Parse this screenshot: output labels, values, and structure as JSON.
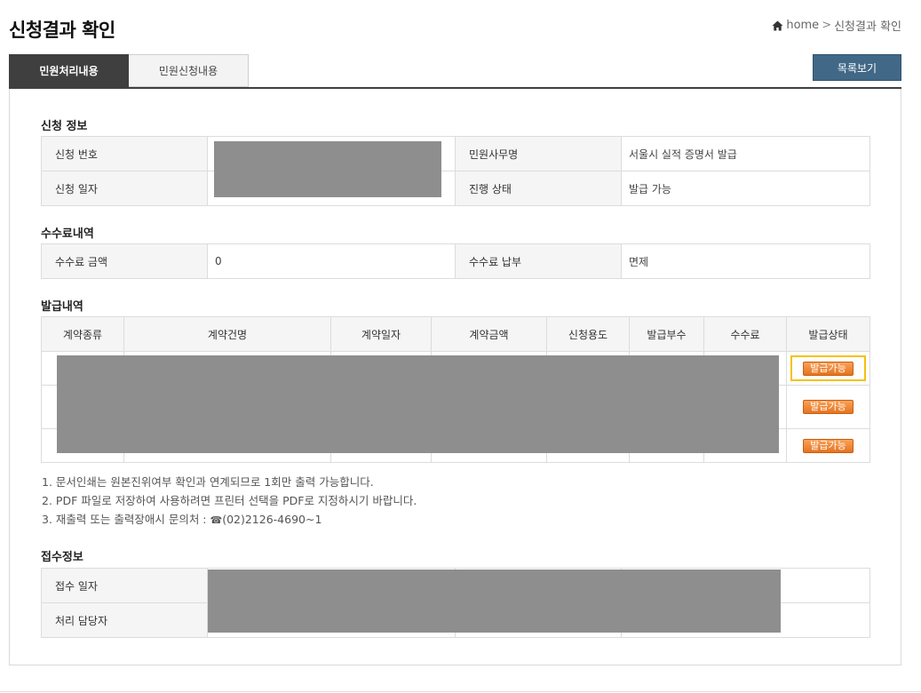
{
  "page": {
    "title": "신청결과 확인"
  },
  "breadcrumb": {
    "home_icon": "home-icon",
    "home": "home",
    "separator": ">",
    "current": "신청결과 확인"
  },
  "tabs": [
    {
      "label": "민원처리내용",
      "active": true
    },
    {
      "label": "민원신청내용",
      "active": false
    }
  ],
  "list_button": {
    "label": "목록보기",
    "color": "#416886"
  },
  "application_info": {
    "title": "신청 정보",
    "number_label": "신청 번호",
    "date_label": "신청 일자",
    "office_label": "민원사무명",
    "office_value": "서울시 실적 증명서 발급",
    "status_label": "진행 상태",
    "status_value": "발급 가능"
  },
  "fee_info": {
    "title": "수수료내역",
    "amount_label": "수수료 금액",
    "amount_value": "0",
    "payment_label": "수수료 납부",
    "payment_value": "면제"
  },
  "issue_info": {
    "title": "발급내역",
    "columns": [
      "계약종류",
      "계약건명",
      "계약일자",
      "계약금액",
      "신청용도",
      "발급부수",
      "수수료",
      "발급상태"
    ],
    "rows": [
      {
        "status": "발급가능"
      },
      {
        "status": "발급가능"
      },
      {
        "status": "발급가능"
      }
    ],
    "badge_color": "#ec7f2c",
    "focus_color": "#f4c20d"
  },
  "notes": {
    "line1": "1. 문서인쇄는 원본진위여부 확인과 연계되므로 1회만 출력 가능합니다.",
    "line2": "2. PDF 파일로 저장하여 사용하려면 프린터 선택을 PDF로 지정하시기 바랍니다.",
    "line3_prefix": "3. 재출력 또는 출력장애시 문의처 : ",
    "phone_icon": "phone-icon",
    "phone": "(02)2126-4690~1"
  },
  "receipt_info": {
    "title": "접수정보",
    "date_label": "접수 일자",
    "manager_label": "처리 담당자"
  }
}
